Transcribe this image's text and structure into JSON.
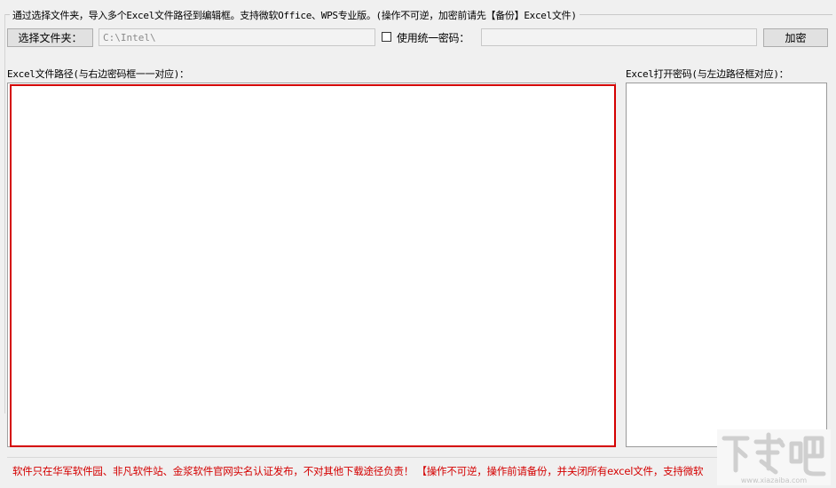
{
  "group": {
    "title": "通过选择文件夹，导入多个Excel文件路径到编辑框。支持微软Office、WPS专业版。(操作不可逆，加密前请先【备份】Excel文件)"
  },
  "toolbar": {
    "select_folder_label": "选择文件夹：",
    "folder_path_value": "C:\\Intel\\",
    "use_unified_password_label": "使用统一密码：",
    "use_unified_password_checked": false,
    "unified_password_value": "",
    "encrypt_label": "加密"
  },
  "left_panel": {
    "label": "Excel文件路径(与右边密码框一一对应)：",
    "content": ""
  },
  "right_panel": {
    "label": "Excel打开密码(与左边路径框对应)：",
    "content": ""
  },
  "footer": {
    "notice": "软件只在华军软件园、非凡软件站、金浆软件官网实名认证发布，不对其他下载途径负责！ 【操作不可逆，操作前请备份，并关闭所有excel文件，支持微软"
  },
  "watermark": {
    "text": "下载吧",
    "url_text": "www.xiazaiba.com"
  },
  "colors": {
    "window_bg": "#f0f0f0",
    "highlight_border": "#d40000",
    "footer_text": "#d40000"
  }
}
